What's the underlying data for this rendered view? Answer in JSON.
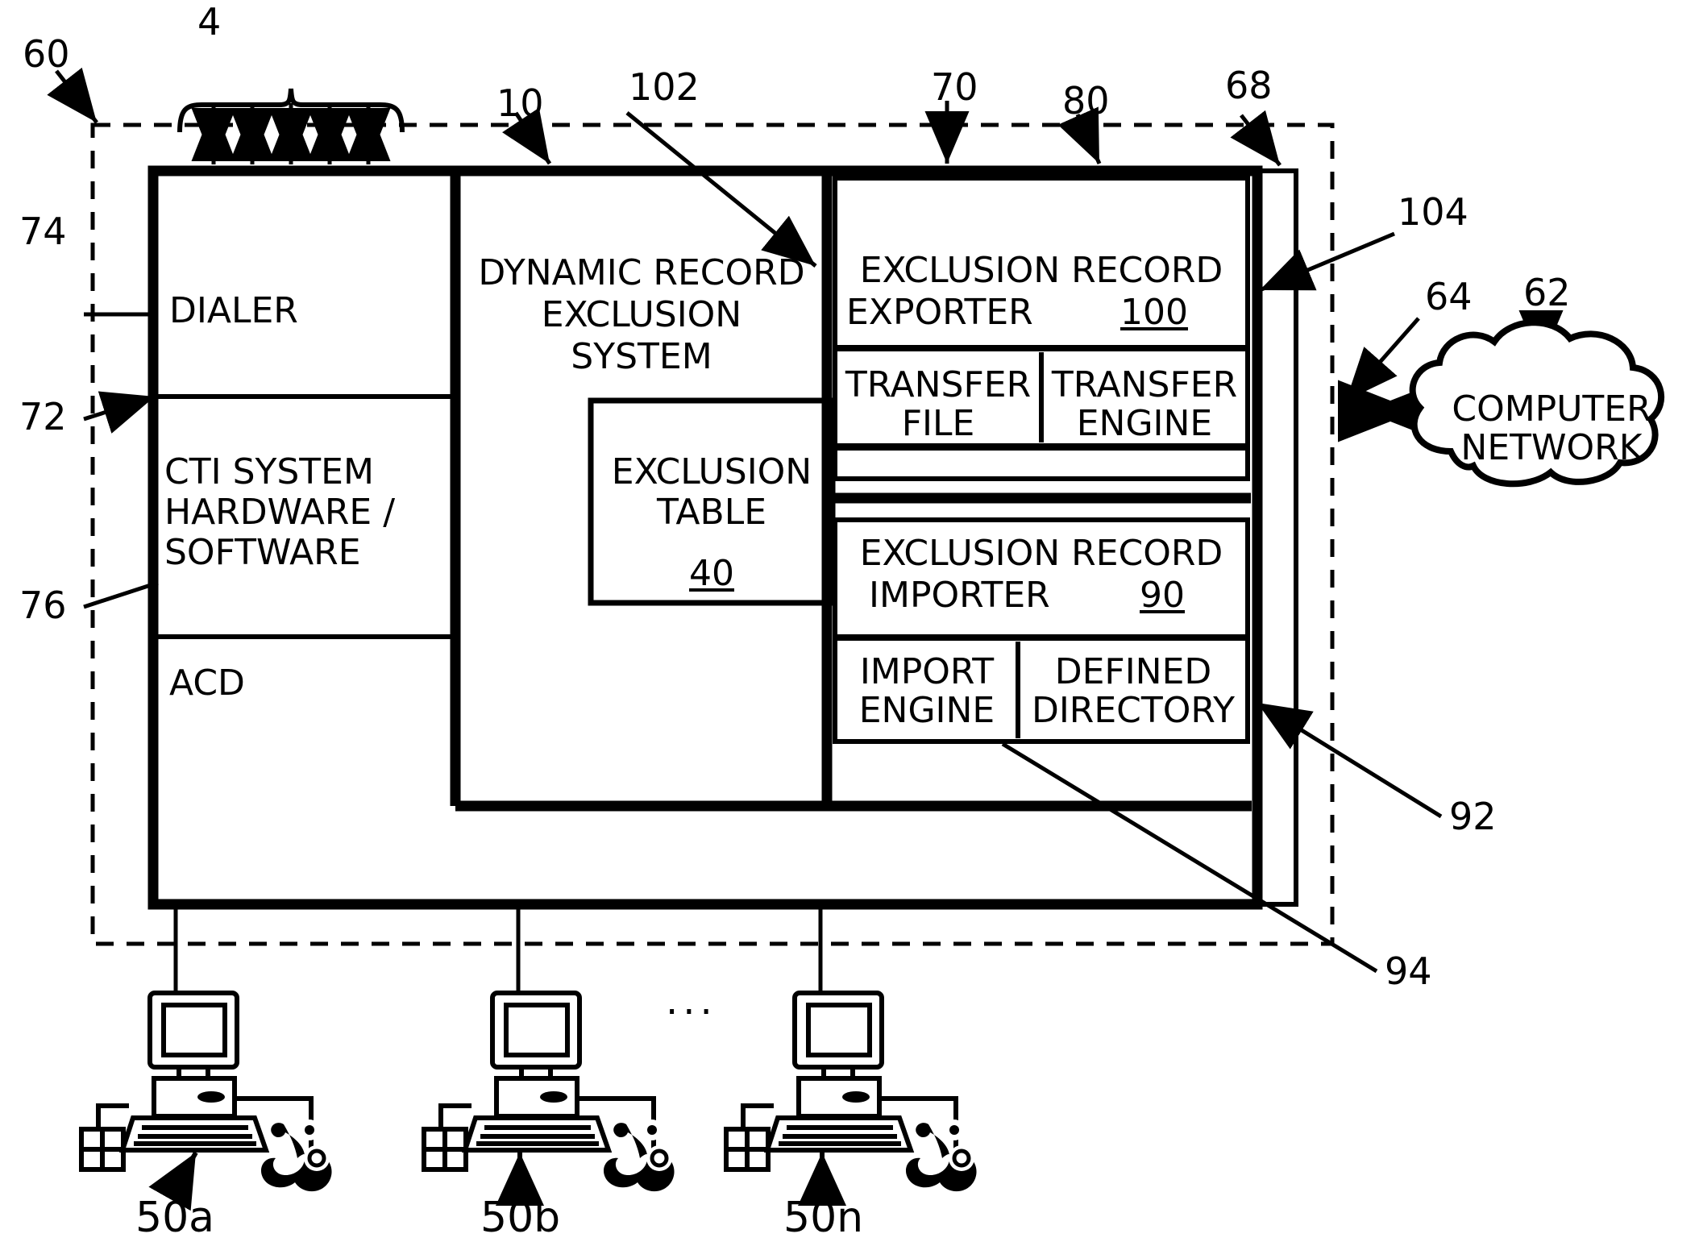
{
  "figure": {
    "type": "patent-block-diagram",
    "reference_numerals": [
      {
        "id": "4",
        "label": "4"
      },
      {
        "id": "60",
        "label": "60"
      },
      {
        "id": "10",
        "label": "10"
      },
      {
        "id": "102",
        "label": "102"
      },
      {
        "id": "70",
        "label": "70"
      },
      {
        "id": "80",
        "label": "80"
      },
      {
        "id": "68",
        "label": "68"
      },
      {
        "id": "104",
        "label": "104"
      },
      {
        "id": "64",
        "label": "64"
      },
      {
        "id": "62",
        "label": "62"
      },
      {
        "id": "74",
        "label": "74"
      },
      {
        "id": "72",
        "label": "72"
      },
      {
        "id": "76",
        "label": "76"
      },
      {
        "id": "92",
        "label": "92"
      },
      {
        "id": "94",
        "label": "94"
      },
      {
        "id": "50a",
        "label": "50a"
      },
      {
        "id": "50b",
        "label": "50b"
      },
      {
        "id": "50n",
        "label": "50n"
      },
      {
        "id": "ellipsis",
        "label": "..."
      }
    ]
  },
  "cti_system": {
    "dialer": "DIALER",
    "hardware_software_line1": "CTI SYSTEM",
    "hardware_software_line2": "HARDWARE /",
    "hardware_software_line3": "SOFTWARE",
    "acd": "ACD"
  },
  "dres": {
    "title_line1": "DYNAMIC RECORD",
    "title_line2": "EXCLUSION",
    "title_line3": "SYSTEM",
    "exclusion_table": {
      "line1": "EXCLUSION",
      "line2": "TABLE",
      "numeral": "40"
    }
  },
  "exporter": {
    "title_line1": "EXCLUSION RECORD",
    "title_line2": "EXPORTER",
    "numeral": "100",
    "transfer_file_line1": "TRANSFER",
    "transfer_file_line2": "FILE",
    "transfer_engine_line1": "TRANSFER",
    "transfer_engine_line2": "ENGINE"
  },
  "importer": {
    "title_line1": "EXCLUSION RECORD",
    "title_line2": "IMPORTER",
    "numeral": "90",
    "import_engine_line1": "IMPORT",
    "import_engine_line2": "ENGINE",
    "defined_directory_line1": "DEFINED",
    "defined_directory_line2": "DIRECTORY"
  },
  "network": {
    "line1": "COMPUTER",
    "line2": "NETWORK"
  },
  "workstations": [
    {
      "label": "50a"
    },
    {
      "label": "50b"
    },
    {
      "label": "50n"
    }
  ],
  "colors": {
    "ink": "#000000",
    "paper": "#ffffff"
  }
}
